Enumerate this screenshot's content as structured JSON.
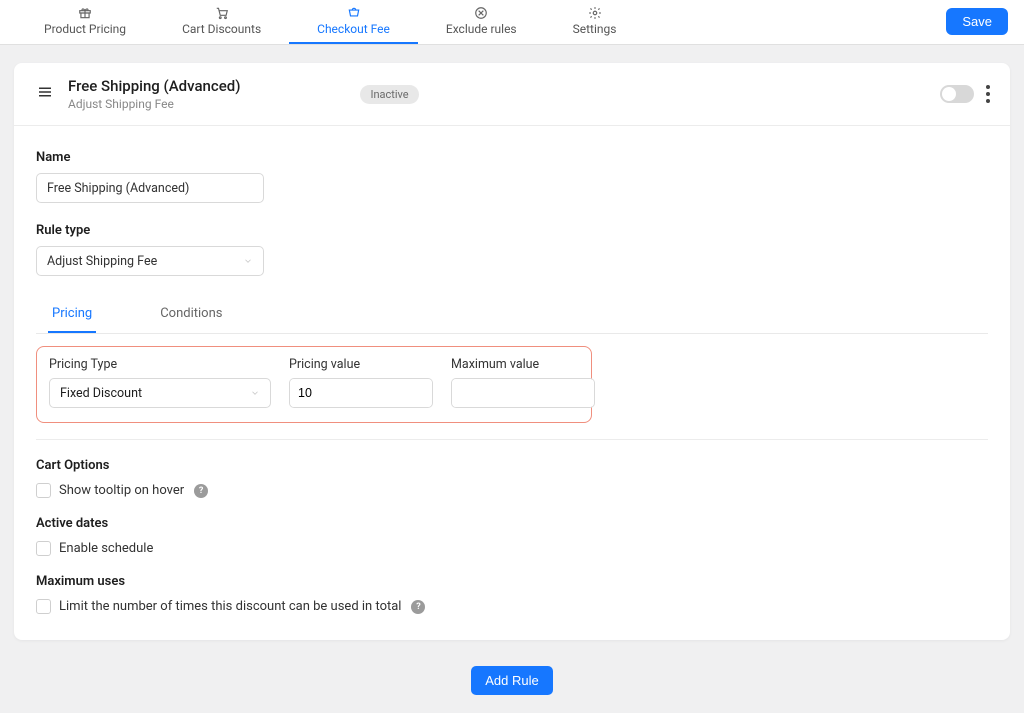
{
  "nav": {
    "tabs": [
      {
        "label": "Product Pricing"
      },
      {
        "label": "Cart Discounts"
      },
      {
        "label": "Checkout Fee"
      },
      {
        "label": "Exclude rules"
      },
      {
        "label": "Settings"
      }
    ],
    "save_label": "Save"
  },
  "header": {
    "title": "Free Shipping (Advanced)",
    "subtitle": "Adjust Shipping Fee",
    "status_badge": "Inactive"
  },
  "form": {
    "name_label": "Name",
    "name_value": "Free Shipping (Advanced)",
    "rule_type_label": "Rule type",
    "rule_type_value": "Adjust Shipping Fee",
    "subtabs": [
      {
        "label": "Pricing"
      },
      {
        "label": "Conditions"
      }
    ],
    "pricing_type_label": "Pricing Type",
    "pricing_type_value": "Fixed Discount",
    "pricing_value_label": "Pricing value",
    "pricing_value_value": "10",
    "pricing_value_unit": "$",
    "max_value_label": "Maximum value",
    "max_value_value": "",
    "max_value_unit": "$",
    "cart_options_title": "Cart Options",
    "cart_options_tooltip": "Show tooltip on hover",
    "active_dates_title": "Active dates",
    "enable_schedule": "Enable schedule",
    "max_uses_title": "Maximum uses",
    "max_uses_limit": "Limit the number of times this discount can be used in total"
  },
  "footer": {
    "add_rule_label": "Add Rule"
  }
}
